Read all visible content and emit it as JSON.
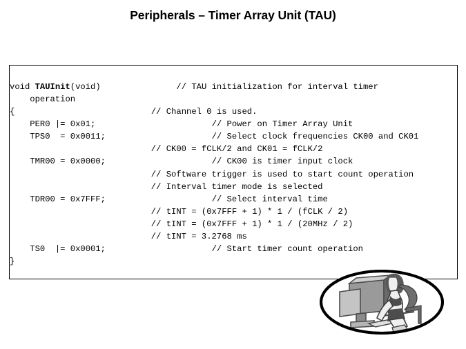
{
  "slide": {
    "title": "Peripherals – Timer Array Unit (TAU)",
    "background_color": "#ffffff",
    "text_color": "#000000"
  },
  "code_box": {
    "border_color": "#000000",
    "background_color": "#ffffff",
    "language": "c",
    "lines": [
      {
        "indent": 0,
        "code": "void ",
        "bold": "TAUInit",
        "code_after": "(void)",
        "comment_col": 33,
        "comment": "// TAU initialization for interval timer"
      },
      {
        "indent": 4,
        "code": "operation",
        "bold": "",
        "code_after": "",
        "comment_col": 0,
        "comment": ""
      },
      {
        "indent": 0,
        "code": "{",
        "bold": "",
        "code_after": "",
        "comment_col": 28,
        "comment": "// Channel 0 is used."
      },
      {
        "indent": 4,
        "code": "PER0 |= 0x01;",
        "bold": "",
        "code_after": "",
        "comment_col": 40,
        "comment": "// Power on Timer Array Unit"
      },
      {
        "indent": 4,
        "code": "TPS0  = 0x0011;",
        "bold": "",
        "code_after": "",
        "comment_col": 40,
        "comment": "// Select clock frequencies CK00 and CK01"
      },
      {
        "indent": 0,
        "code": "",
        "bold": "",
        "code_after": "",
        "comment_col": 28,
        "comment": "// CK00 = fCLK/2 and CK01 = fCLK/2"
      },
      {
        "indent": 4,
        "code": "TMR00 = 0x0000;",
        "bold": "",
        "code_after": "",
        "comment_col": 40,
        "comment": "// CK00 is timer input clock"
      },
      {
        "indent": 0,
        "code": "",
        "bold": "",
        "code_after": "",
        "comment_col": 28,
        "comment": "// Software trigger is used to start count operation"
      },
      {
        "indent": 0,
        "code": "",
        "bold": "",
        "code_after": "",
        "comment_col": 28,
        "comment": "// Interval timer mode is selected"
      },
      {
        "indent": 4,
        "code": "TDR00 = 0x7FFF;",
        "bold": "",
        "code_after": "",
        "comment_col": 40,
        "comment": "// Select interval time"
      },
      {
        "indent": 0,
        "code": "",
        "bold": "",
        "code_after": "",
        "comment_col": 28,
        "comment": "// tINT = (0x7FFF + 1) * 1 / (fCLK / 2)"
      },
      {
        "indent": 0,
        "code": "",
        "bold": "",
        "code_after": "",
        "comment_col": 28,
        "comment": "// tINT = (0x7FFF + 1) * 1 / (20MHz / 2)"
      },
      {
        "indent": 0,
        "code": "",
        "bold": "",
        "code_after": "",
        "comment_col": 28,
        "comment": "// tINT = 3.2768 ms"
      },
      {
        "indent": 4,
        "code": "TS0  |= 0x0001;",
        "bold": "",
        "code_after": "",
        "comment_col": 40,
        "comment": "// Start timer count operation"
      },
      {
        "indent": 0,
        "code": "}",
        "bold": "",
        "code_after": "",
        "comment_col": 0,
        "comment": ""
      }
    ]
  },
  "logo": {
    "name": "oval-workstation-logo",
    "description": "Oval badge with grayscale illustration of a person seated at a computer workstation",
    "outline_color": "#000000",
    "fill_color": "#ffffff",
    "shade_dark": "#4d4d4d",
    "shade_mid": "#8a8a8a",
    "shade_light": "#bdbdbd"
  }
}
